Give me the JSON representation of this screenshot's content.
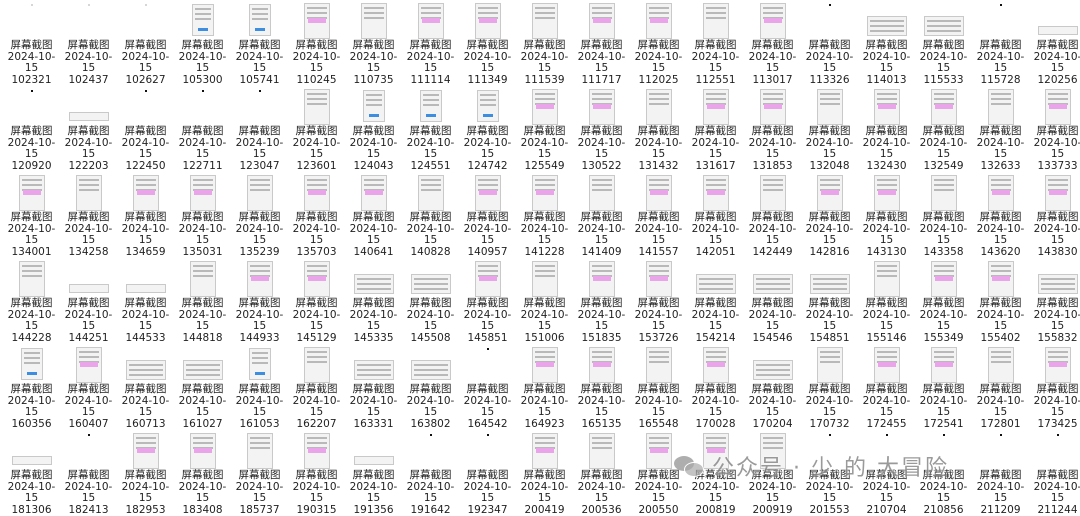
{
  "folder_view": {
    "label_prefix": "屏幕截图",
    "date": "2024-10-",
    "day": "15",
    "files": [
      "102321",
      "102437",
      "102627",
      "105300",
      "105741",
      "110245",
      "110735",
      "111114",
      "111349",
      "111539",
      "111717",
      "112025",
      "112551",
      "113017",
      "113326",
      "114013",
      "115533",
      "115728",
      "120256",
      "120920",
      "122203",
      "122450",
      "122711",
      "123047",
      "123601",
      "124043",
      "124551",
      "124742",
      "125549",
      "130522",
      "131432",
      "131617",
      "131853",
      "132048",
      "132430",
      "132549",
      "132633",
      "133733",
      "134001",
      "134258",
      "134659",
      "135031",
      "135239",
      "135703",
      "140641",
      "140828",
      "140957",
      "141228",
      "141409",
      "141557",
      "142051",
      "142449",
      "142816",
      "143130",
      "143358",
      "143620",
      "143830",
      "144228",
      "144251",
      "144533",
      "144818",
      "144933",
      "145129",
      "145335",
      "145508",
      "145851",
      "151006",
      "151835",
      "153726",
      "154214",
      "154546",
      "154851",
      "155146",
      "155349",
      "155402",
      "155832",
      "160356",
      "160407",
      "160713",
      "161027",
      "161053",
      "162207",
      "163331",
      "163802",
      "164542",
      "164923",
      "165135",
      "165548",
      "170028",
      "170204",
      "170732",
      "172455",
      "172541",
      "172801",
      "173425",
      "181306",
      "182413",
      "182953",
      "183408",
      "185737",
      "190315",
      "191356",
      "191642",
      "192347",
      "200419",
      "200536",
      "200550",
      "200819",
      "200919",
      "201553",
      "210704",
      "210856",
      "211209",
      "211244"
    ],
    "thumbs": [
      "doc",
      "doc",
      "doc",
      "portrait",
      "portrait",
      "tall",
      "tall",
      "tall",
      "tall",
      "tall",
      "tall",
      "tall",
      "tall",
      "tall",
      "dark",
      "wide",
      "wide",
      "dark",
      "strip",
      "dark",
      "strip",
      "dark",
      "dark",
      "dark",
      "tall",
      "portrait",
      "portrait",
      "portrait",
      "tall",
      "tall",
      "tall",
      "tall",
      "tall",
      "tall",
      "tall",
      "tall",
      "tall",
      "tall",
      "tall",
      "tall",
      "tall",
      "tall",
      "tall",
      "tall",
      "tall",
      "tall",
      "tall",
      "tall",
      "tall",
      "tall",
      "tall",
      "tall",
      "tall",
      "tall",
      "tall",
      "tall",
      "tall",
      "tall",
      "strip",
      "strip",
      "tall",
      "tall",
      "tall",
      "wide",
      "wide",
      "tall",
      "tall",
      "tall",
      "tall",
      "wide",
      "wide",
      "wide",
      "tall",
      "tall",
      "tall",
      "wide",
      "portrait",
      "tall",
      "wide",
      "wide",
      "portrait",
      "tall",
      "wide",
      "wide",
      "dark",
      "tall",
      "tall",
      "tall",
      "tall",
      "wide",
      "tall",
      "tall",
      "tall",
      "tall",
      "tall",
      "strip",
      "dark",
      "tall",
      "tall",
      "tall",
      "tall",
      "strip",
      "dark",
      "dark",
      "tall",
      "tall",
      "tall",
      "tall",
      "tall",
      "dark",
      "dark",
      "dark",
      "dark",
      "dark"
    ]
  },
  "watermark": {
    "text": "公众号 · 少 的 大冒险",
    "icon": "wechat-icon"
  }
}
